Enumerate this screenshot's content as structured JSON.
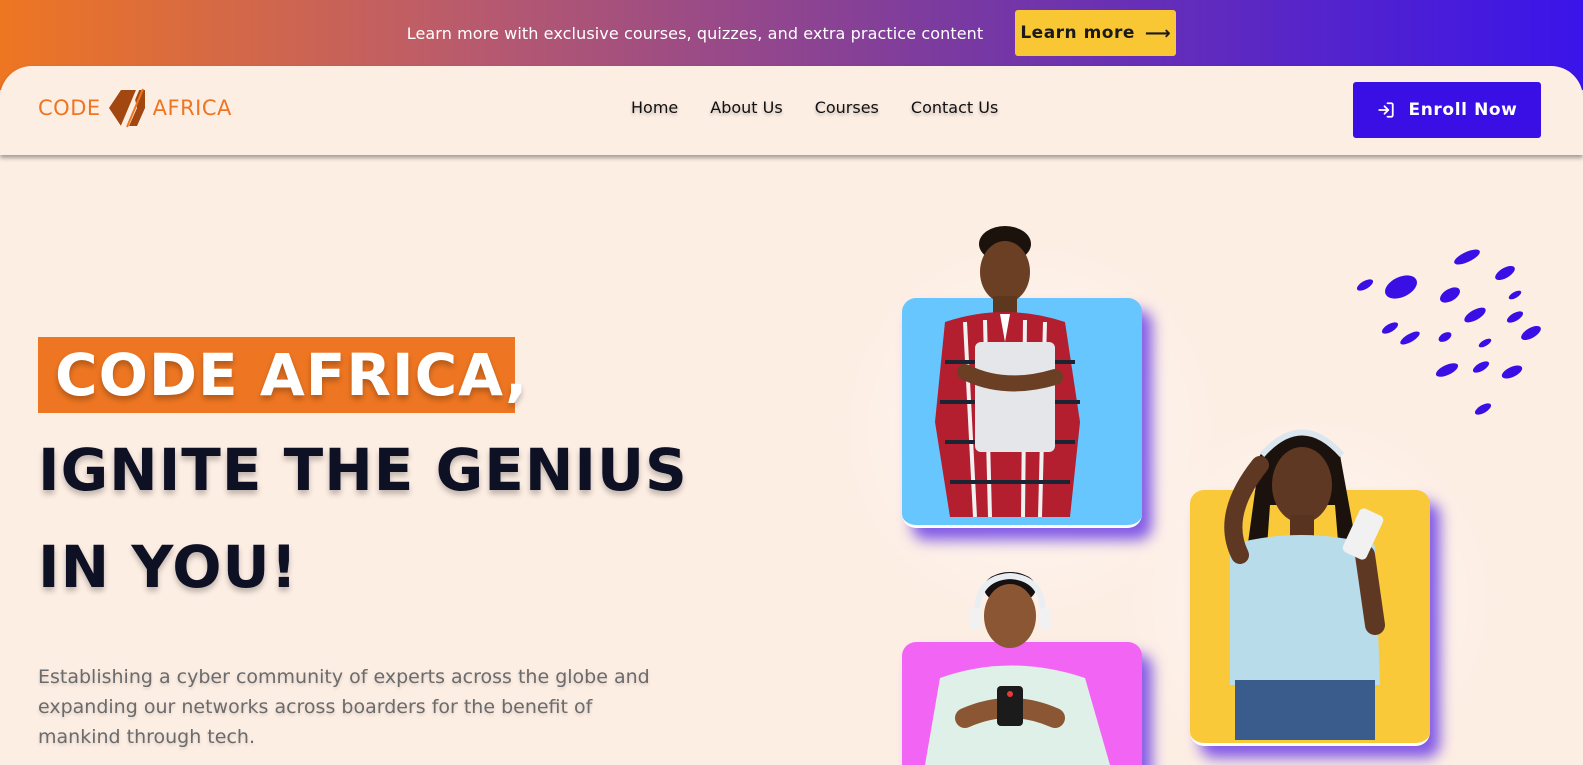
{
  "banner": {
    "text": "Learn more with exclusive courses, quizzes, and extra practice content",
    "button_label": "Learn more",
    "button_icon": "arrow-right-icon"
  },
  "header": {
    "logo_left": "CODE",
    "logo_right": "AFRICA",
    "nav": [
      "Home",
      "About Us",
      "Courses",
      "Contact Us"
    ],
    "enroll_label": "Enroll Now",
    "enroll_icon": "sign-in-icon"
  },
  "hero": {
    "line1": "CODE AFRICA,",
    "line2": "IGNITE THE GENIUS",
    "line3": "IN YOU!",
    "description": "Establishing a cyber community of experts across the globe and expanding our networks across boarders for the benefit of mankind through tech."
  },
  "colors": {
    "brand_orange": "#ee7622",
    "brand_purple": "#3a0fe6",
    "banner_yellow": "#f9c734",
    "background": "#fdeee4",
    "card_blue": "#66c6fd",
    "card_yellow": "#f9c93a",
    "card_pink": "#f265f4"
  }
}
